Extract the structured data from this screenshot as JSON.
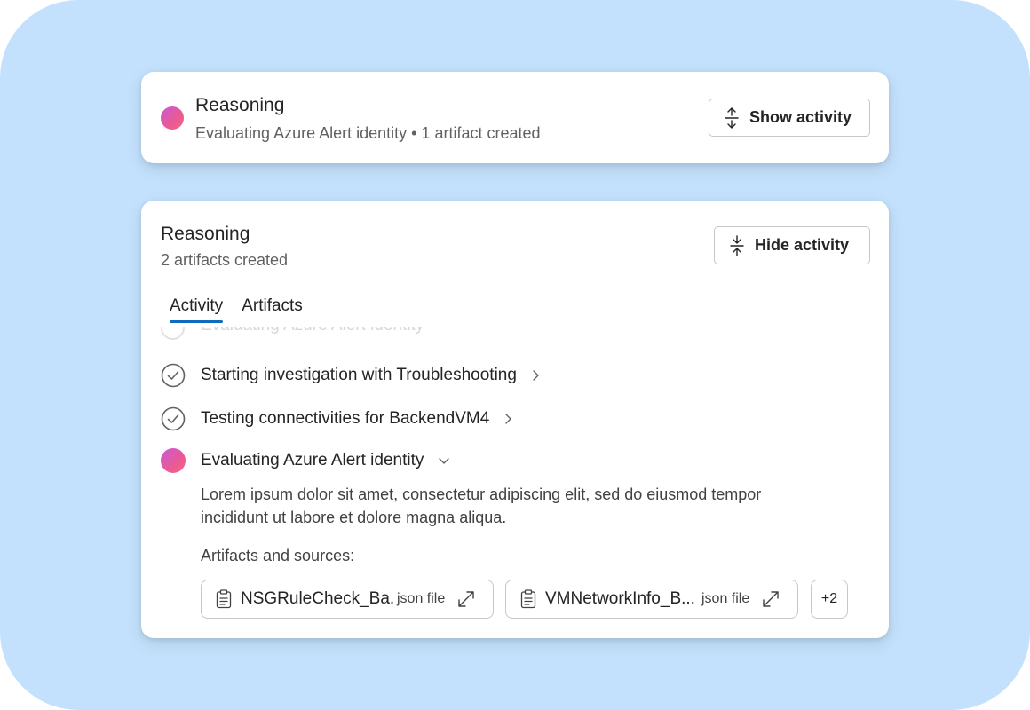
{
  "card_collapsed": {
    "title": "Reasoning",
    "subtitle": "Evaluating Azure Alert identity • 1 artifact created",
    "button_label": "Show activity",
    "button_icon": "expand-vertical-icon"
  },
  "card_expanded": {
    "title": "Reasoning",
    "subtitle": "2 artifacts created",
    "button_label": "Hide activity",
    "button_icon": "collapse-vertical-icon",
    "tabs": [
      {
        "label": "Activity",
        "active": true
      },
      {
        "label": "Artifacts",
        "active": false
      }
    ],
    "steps": [
      {
        "label": "Evaluating Azure Alert identity",
        "status": "faded"
      },
      {
        "label": "Starting investigation with Troubleshooting",
        "status": "done"
      },
      {
        "label": "Testing connectivities for BackendVM4",
        "status": "done"
      },
      {
        "label": "Evaluating Azure Alert identity",
        "status": "in-progress"
      }
    ],
    "description": "Lorem ipsum dolor sit amet, consectetur adipiscing elit, sed do eiusmod tempor incididunt ut labore et dolore magna aliqua.",
    "artifacts_label": "Artifacts and sources:",
    "artifacts": [
      {
        "name": "NSGRuleCheck_Ba...",
        "type": "json file"
      },
      {
        "name": "VMNetworkInfo_B...",
        "type": "json file"
      }
    ],
    "more_count": "+2"
  },
  "colors": {
    "background": "#c3e1fc",
    "tab_underline": "#0f6cbd",
    "dot_gradient": [
      "#c85ad6",
      "#f2688a"
    ]
  }
}
